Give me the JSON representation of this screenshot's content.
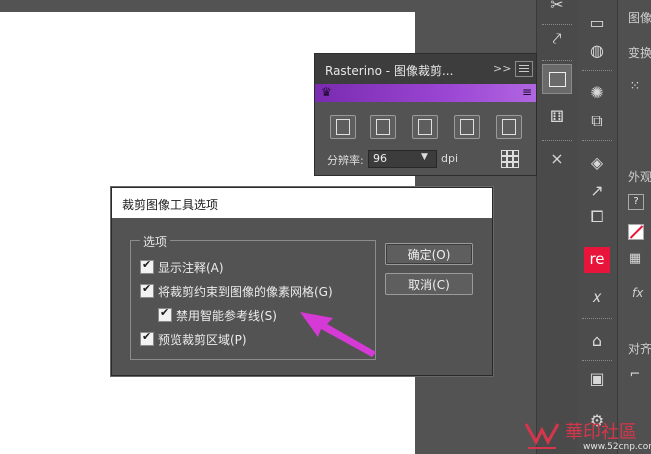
{
  "rasterino": {
    "title": "Rasterino - 图像裁剪...",
    "expand_label": ">>",
    "resolution_label": "分辨率:",
    "resolution_value": "96",
    "resolution_unit": "dpi"
  },
  "dialog": {
    "title": "裁剪图像工具选项",
    "group_label": "选项",
    "options": [
      {
        "label": "显示注释(A)",
        "checked": true
      },
      {
        "label": "将裁剪约束到图像的像素网格(G)",
        "checked": true
      },
      {
        "label": "禁用智能参考线(S)",
        "checked": true
      },
      {
        "label": "预览裁剪区域(P)",
        "checked": true
      }
    ],
    "ok_label": "确定(O)",
    "cancel_label": "取消(C)"
  },
  "right_panel": {
    "label_image": "图像",
    "label_transform": "变换",
    "label_appearance": "外观",
    "label_fx": "fx",
    "label_align": "对齐",
    "help_label": "?"
  },
  "re_badge": {
    "label": "re",
    "color": "#e8143a"
  },
  "annotation": {
    "arrow_color": "#d63ad6"
  },
  "watermark": {
    "text": "華印社區",
    "url": "www.52cnp.com"
  }
}
